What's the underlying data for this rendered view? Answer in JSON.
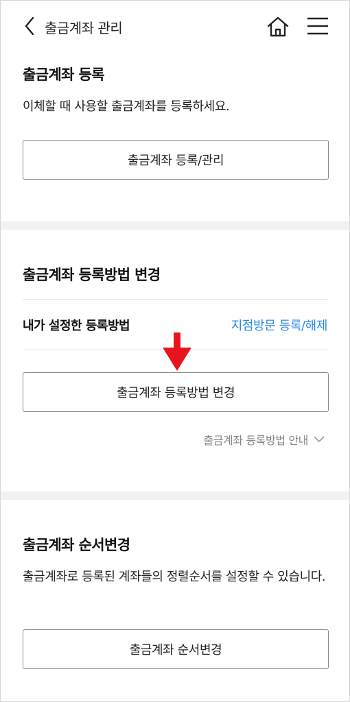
{
  "header": {
    "title": "출금계좌 관리",
    "back_icon": "chevron-left-icon",
    "home_icon": "home-icon",
    "menu_icon": "hamburger-menu-icon"
  },
  "section_register": {
    "title": "출금계좌 등록",
    "description": "이체할 때 사용할 출금계좌를 등록하세요.",
    "button_label": "출금계좌 등록/관리"
  },
  "section_method": {
    "title": "출금계좌 등록방법 변경",
    "row_label": "내가 설정한 등록방법",
    "row_value": "지점방문 등록/해제",
    "button_label": "출금계좌 등록방법 변경",
    "guide_label": "출금계좌 등록방법 안내",
    "guide_icon": "chevron-down-icon"
  },
  "section_order": {
    "title": "출금계좌 순서변경",
    "description": "출금계좌로 등록된 계좌들의 정렬순서를 설정할 수 있습니다.",
    "button_label": "출금계좌 순서변경"
  },
  "colors": {
    "link": "#2b8be6",
    "band": "#f0f1f3",
    "arrow": "#e8141b"
  }
}
